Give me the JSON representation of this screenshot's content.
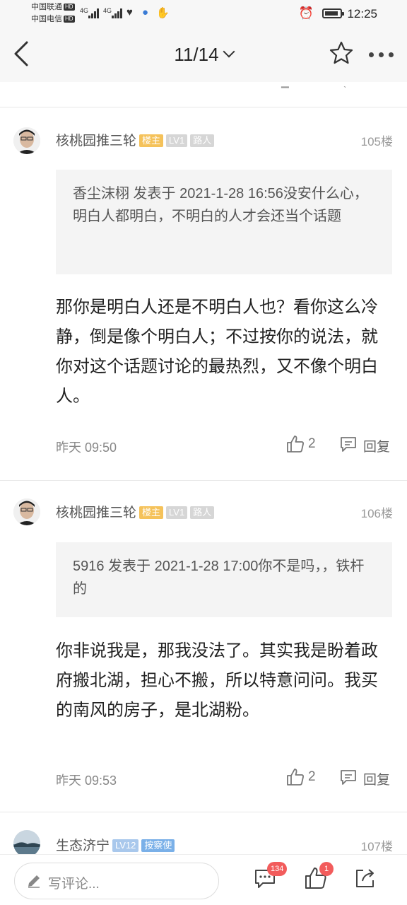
{
  "status_bar": {
    "carrier1": "中国联通",
    "carrier2": "中国电信",
    "hd": "HD",
    "network1": "4G",
    "network2": "4G",
    "time": "12:25"
  },
  "header": {
    "page_indicator": "11/14"
  },
  "posts": [
    {
      "username": "核桃园推三轮",
      "badges": [
        "楼主",
        "LV1",
        "路人"
      ],
      "floor": "105楼",
      "quote": "香尘沫栩 发表于 2021-1-28 16:56没安什么心，明白人都明白，不明白的人才会还当个话题",
      "body": "那你是明白人还是不明白人也？看你这么冷静，倒是像个明白人；不过按你的说法，就你对这个话题讨论的最热烈，又不像个明白人。",
      "time": "昨天 09:50",
      "likes": "2",
      "reply_label": "回复"
    },
    {
      "username": "核桃园推三轮",
      "badges": [
        "楼主",
        "LV1",
        "路人"
      ],
      "floor": "106楼",
      "quote": "5916 发表于 2021-1-28 17:00你不是吗，，铁杆的",
      "body": "你非说我是，那我没法了。其实我是盼着政府搬北湖，担心不搬，所以特意问问。我买的南风的房子，是北湖粉。",
      "time": "昨天 09:53",
      "likes": "2",
      "reply_label": "回复"
    },
    {
      "username": "生态济宁",
      "badges": [
        "LV12",
        "按察使"
      ],
      "floor": "107楼"
    }
  ],
  "bottom_bar": {
    "comment_placeholder": "写评论...",
    "comment_count": "134",
    "like_count": "1"
  }
}
